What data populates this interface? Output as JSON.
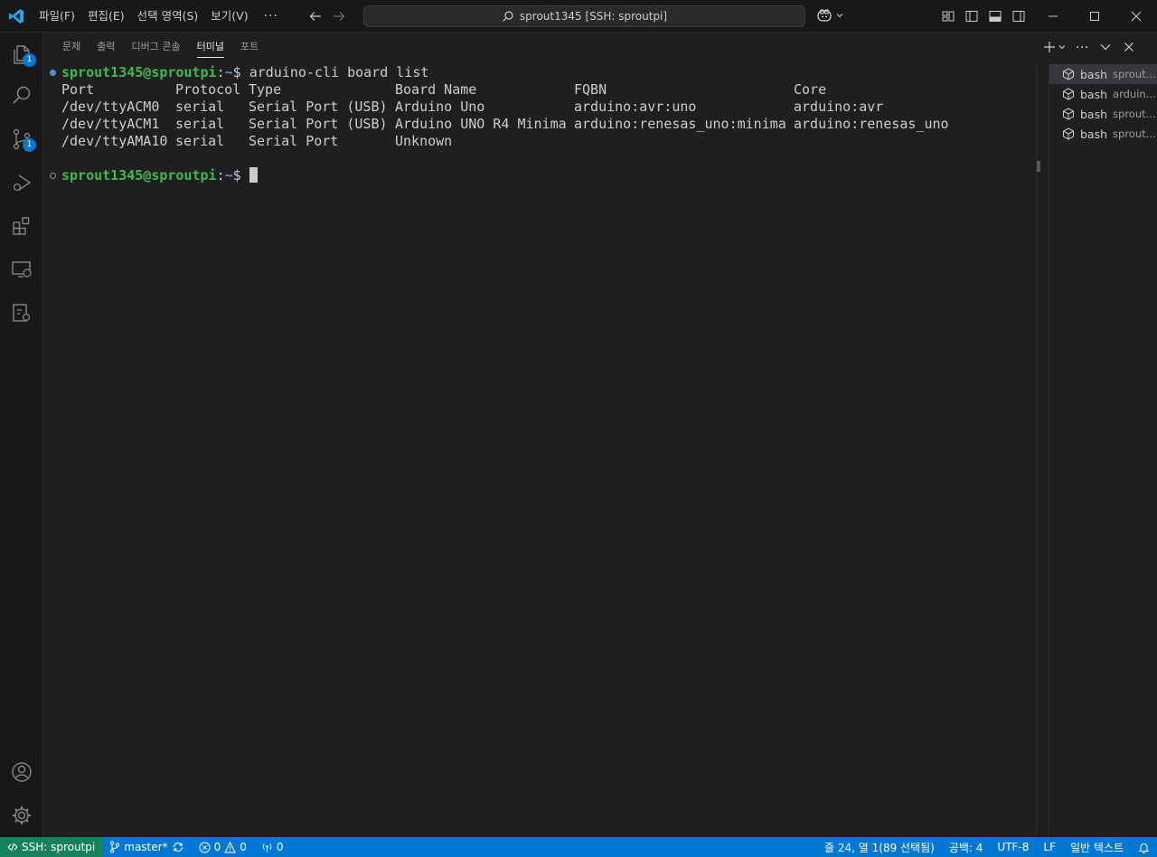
{
  "titlebar": {
    "menus": [
      "파일(F)",
      "편집(E)",
      "선택 영역(S)",
      "보기(V)"
    ],
    "more": "···",
    "search_text": "sprout1345 [SSH: sproutpi]"
  },
  "activitybar": {
    "explorer_badge": "1",
    "scm_badge": "1"
  },
  "panel": {
    "tabs": [
      "문제",
      "출력",
      "디버그 콘솔",
      "터미널",
      "포트"
    ],
    "active_tab": "터미널"
  },
  "terminal": {
    "prompt_user": "sprout1345@sproutpi",
    "prompt_sep": ":",
    "prompt_tilde": "~",
    "prompt_dollar": "$ ",
    "command": "arduino-cli board list",
    "headers": [
      "Port",
      "Protocol",
      "Type",
      "Board Name",
      "FQBN",
      "Core"
    ],
    "rows": [
      [
        "/dev/ttyACM0",
        "serial",
        "Serial Port (USB)",
        "Arduino Uno",
        "arduino:avr:uno",
        "arduino:avr"
      ],
      [
        "/dev/ttyACM1",
        "serial",
        "Serial Port (USB)",
        "Arduino UNO R4 Minima",
        "arduino:renesas_uno:minima",
        "arduino:renesas_uno"
      ],
      [
        "/dev/ttyAMA10",
        "serial",
        "Serial Port",
        "Unknown",
        "",
        ""
      ]
    ]
  },
  "terminal_list": [
    {
      "name": "bash",
      "desc": "sprout..."
    },
    {
      "name": "bash",
      "desc": "arduin..."
    },
    {
      "name": "bash",
      "desc": "sprout..."
    },
    {
      "name": "bash",
      "desc": "sprout..."
    }
  ],
  "statusbar": {
    "remote": "SSH: sproutpi",
    "branch": "master*",
    "errors": "0",
    "warnings": "0",
    "ports": "0",
    "cursor_pos": "줄 24, 열 1(89 선택됨)",
    "spaces": "공백: 4",
    "encoding": "UTF-8",
    "eol": "LF",
    "language": "일반 텍스트"
  },
  "colors": {
    "accent": "#0078d4",
    "remote": "#16825d",
    "prompt_user": "#3fb950",
    "prompt_path": "#5c8fdc"
  }
}
